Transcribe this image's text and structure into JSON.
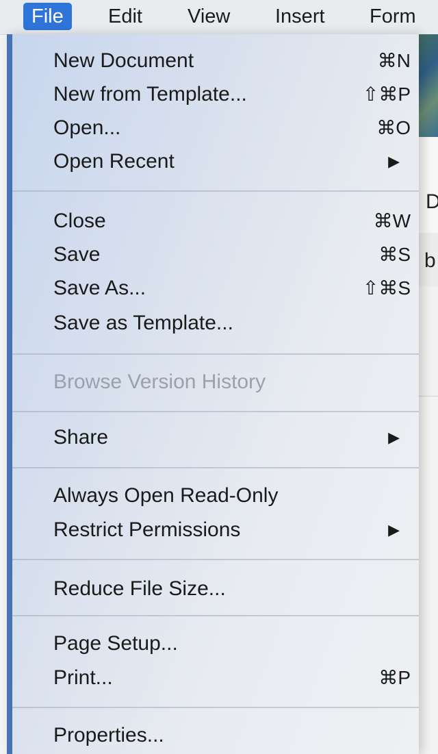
{
  "menubar": {
    "items": [
      "File",
      "Edit",
      "View",
      "Insert",
      "Form"
    ]
  },
  "background": {
    "glyph_1": "D",
    "glyph_2": "b"
  },
  "file_menu": {
    "items": [
      {
        "label": "New Document",
        "shortcut": "⌘N"
      },
      {
        "label": "New from Template...",
        "shortcut": "⇧⌘P"
      },
      {
        "label": "Open...",
        "shortcut": "⌘O"
      },
      {
        "label": "Open Recent",
        "submenu_icon": "triangle-right-icon"
      },
      {
        "label": "Close",
        "shortcut": "⌘W"
      },
      {
        "label": "Save",
        "shortcut": "⌘S"
      },
      {
        "label": "Save As...",
        "shortcut": "⇧⌘S"
      },
      {
        "label": "Save as Template..."
      },
      {
        "label": "Browse Version History",
        "disabled": true
      },
      {
        "label": "Share",
        "submenu_icon": "triangle-right-icon"
      },
      {
        "label": "Always Open Read-Only"
      },
      {
        "label": "Restrict Permissions",
        "submenu_icon": "triangle-right-icon"
      },
      {
        "label": "Reduce File Size..."
      },
      {
        "label": "Page Setup..."
      },
      {
        "label": "Print...",
        "shortcut": "⌘P"
      },
      {
        "label": "Properties..."
      }
    ]
  },
  "colors": {
    "menubar_active": "#2f74d9",
    "disabled_text": "#9aa1aa",
    "menu_left_edge": "#4872b8"
  }
}
